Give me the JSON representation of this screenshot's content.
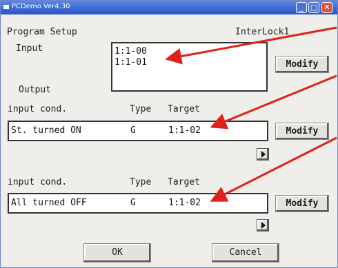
{
  "window": {
    "title": "PCDemo Ver4.30"
  },
  "header": {
    "left": "Program Setup",
    "right": "InterLock1"
  },
  "input": {
    "label": "Input",
    "items": [
      "1:1-00",
      "1:1-01"
    ],
    "modify_label": "Modify"
  },
  "output": {
    "label": "Output"
  },
  "rows": [
    {
      "col_cond": "input cond.",
      "col_type": "Type",
      "col_target": "Target",
      "cond": "St. turned ON",
      "type": "G",
      "target": "1:1-02",
      "modify_label": "Modify"
    },
    {
      "col_cond": "input cond.",
      "col_type": "Type",
      "col_target": "Target",
      "cond": "All turned OFF",
      "type": "G",
      "target": "1:1-02",
      "modify_label": "Modify"
    }
  ],
  "footer": {
    "ok_label": "OK",
    "cancel_label": "Cancel"
  },
  "colors": {
    "annotation_arrow": "#e0201a",
    "titlebar": "#2456c6"
  }
}
